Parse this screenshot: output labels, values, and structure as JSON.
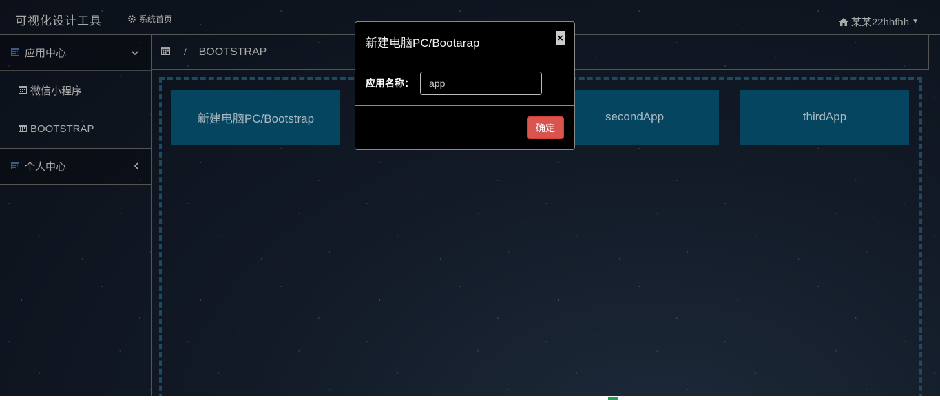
{
  "topbar": {
    "brand": "可视化设计工具",
    "home_icon": "gear-icon",
    "home_label": "系统首页",
    "user_icon": "home-icon",
    "user_label": "某某22hhfhh"
  },
  "sidebar": {
    "groups": [
      {
        "label": "应用中心",
        "icon": "calendar-icon",
        "chevron": "chevron-down-icon",
        "items": [
          {
            "label": "微信小程序",
            "icon": "calendar-icon"
          },
          {
            "label": "BOOTSTRAP",
            "icon": "calendar-icon"
          }
        ]
      },
      {
        "label": "个人中心",
        "icon": "calendar-icon",
        "chevron": "chevron-left-icon",
        "items": []
      }
    ]
  },
  "breadcrumb": {
    "icon": "calendar-icon",
    "separator": "/",
    "current": "BOOTSTRAP"
  },
  "workspace": {
    "cards": [
      {
        "label": "新建电脑PC/Bootstrap"
      },
      {
        "label": "secondApp"
      },
      {
        "label": "thirdApp"
      }
    ]
  },
  "modal": {
    "title": "新建电脑PC/Bootarap",
    "close_label": "×",
    "field_label": "应用名称：",
    "field_value": "app",
    "confirm_label": "确定"
  },
  "colors": {
    "card_bg": "#064560",
    "confirm_bg": "#d9534f",
    "dashed_border": "#1d4a63"
  }
}
